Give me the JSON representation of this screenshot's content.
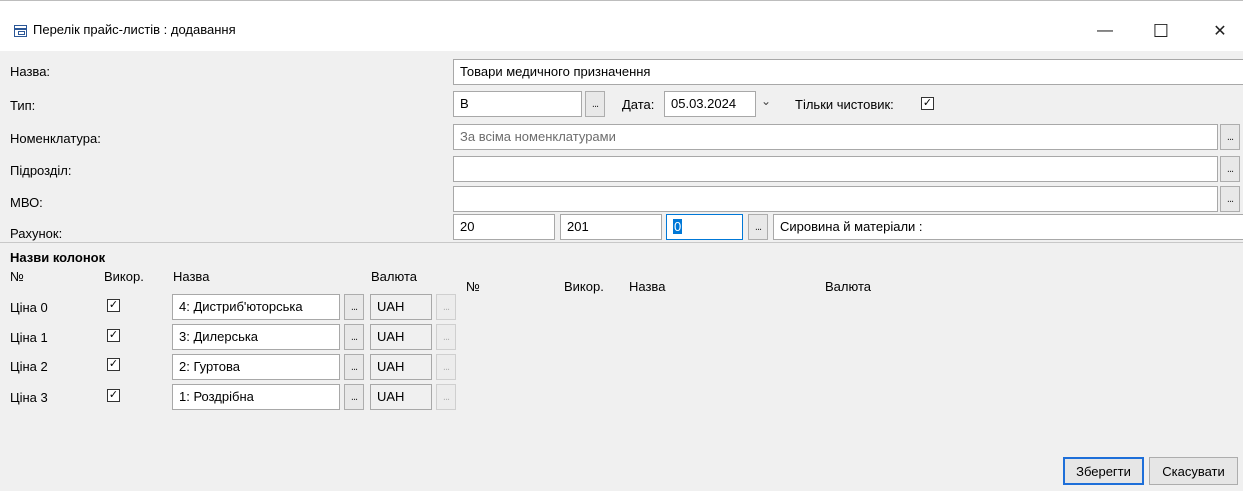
{
  "window": {
    "title": "Перелік прайс-листів : додавання",
    "minimize": "—",
    "maximize": "☐",
    "close": "✕"
  },
  "form": {
    "name_label": "Назва:",
    "name_value": "Товари медичного призначення",
    "type_label": "Тип:",
    "type_value": "В",
    "date_label": "Дата:",
    "date_value": "05.03.2024",
    "date_dropdown": "⌄",
    "drafts_only_label": "Тільки чистовик:",
    "drafts_only_checked": "✓",
    "nomenclature_label": "Номенклатура:",
    "nomenclature_value": "За всіма номенклатурами",
    "division_label": "Підрозділ:",
    "division_value": "",
    "mvo_label": "МВО:",
    "mvo_value": "",
    "account_label": "Рахунок:",
    "account_1": "20",
    "account_2": "201",
    "account_3": "0",
    "account_desc": "Сировина й матеріали :",
    "dots": "..."
  },
  "columns": {
    "section_title": "Назви колонок",
    "headers_left": {
      "num": "№",
      "use": "Викор.",
      "name": "Назва",
      "currency": "Валюта"
    },
    "headers_right": {
      "num": "№",
      "use": "Викор.",
      "name": "Назва",
      "currency": "Валюта"
    },
    "rows": [
      {
        "num": "Ціна 0",
        "checked": "✓",
        "name": "4: Дистриб'юторська",
        "currency": "UAH"
      },
      {
        "num": "Ціна 1",
        "checked": "✓",
        "name": "3: Дилерська",
        "currency": "UAH"
      },
      {
        "num": "Ціна 2",
        "checked": "✓",
        "name": "2: Гуртова",
        "currency": "UAH"
      },
      {
        "num": "Ціна 3",
        "checked": "✓",
        "name": "1: Роздрібна",
        "currency": "UAH"
      }
    ]
  },
  "buttons": {
    "save": "Зберегти",
    "cancel": "Скасувати"
  },
  "colors": {
    "primary_border": "#1e6fd9",
    "selection": "#0078d7",
    "form_background": "#f0f0f0"
  }
}
